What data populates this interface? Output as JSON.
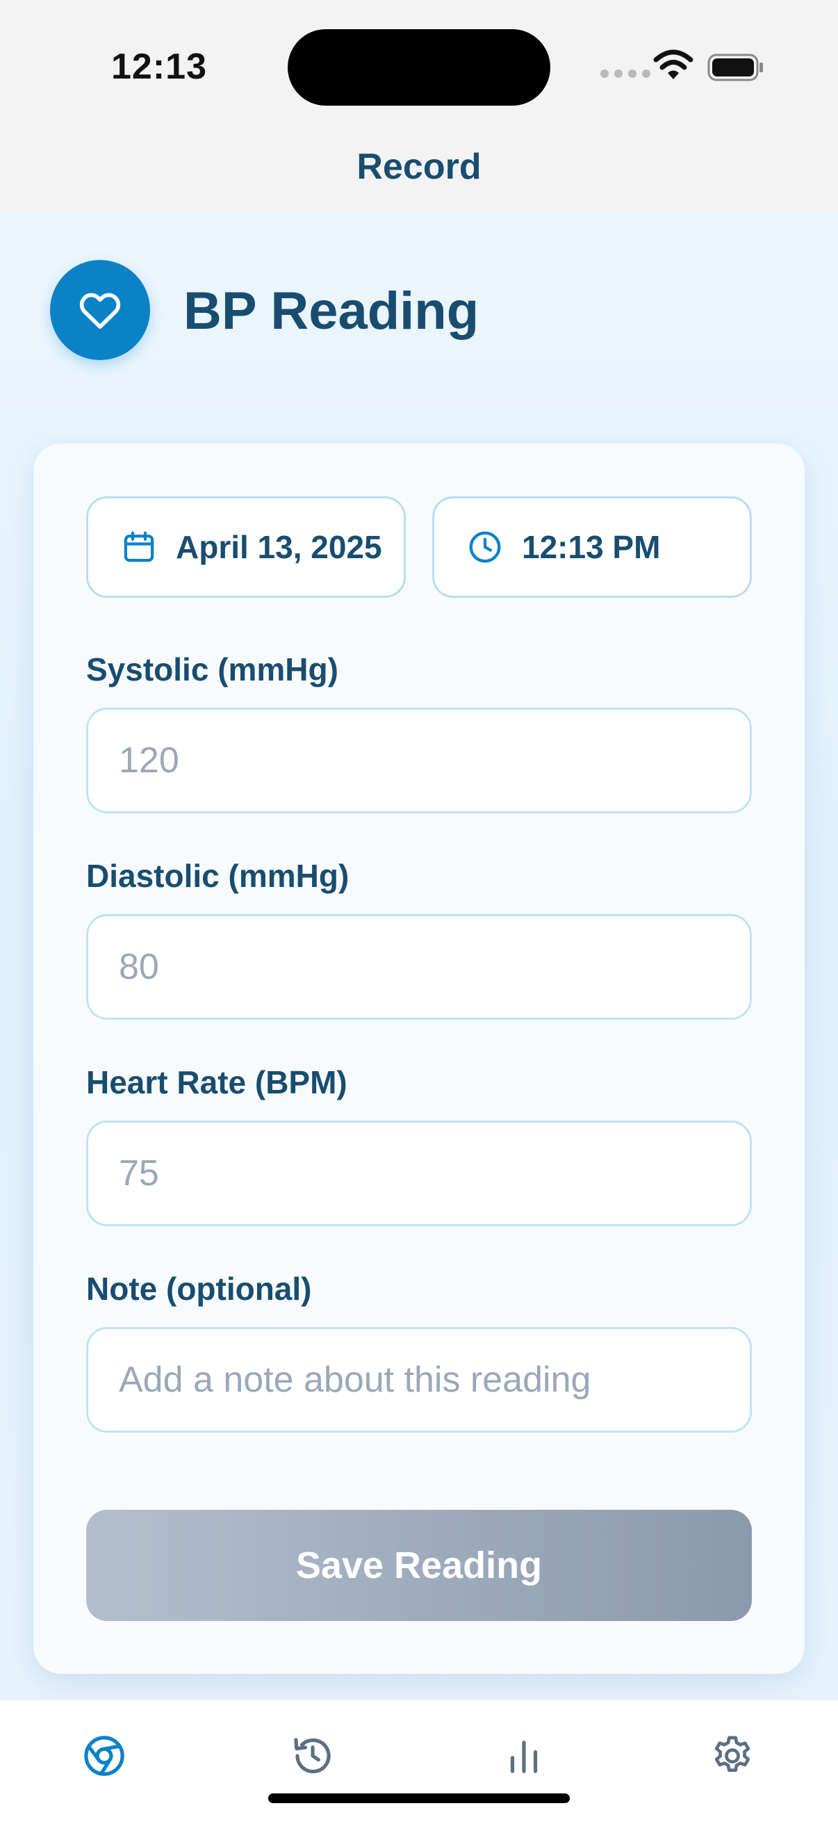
{
  "status_bar": {
    "time": "12:13"
  },
  "nav": {
    "title": "Record"
  },
  "header": {
    "icon": "heart-icon",
    "title": "BP Reading"
  },
  "form": {
    "date": {
      "icon": "calendar-icon",
      "value": "April 13, 2025"
    },
    "time": {
      "icon": "clock-icon",
      "value": "12:13 PM"
    },
    "systolic": {
      "label": "Systolic (mmHg)",
      "placeholder": "120",
      "value": ""
    },
    "diastolic": {
      "label": "Diastolic (mmHg)",
      "placeholder": "80",
      "value": ""
    },
    "heart_rate": {
      "label": "Heart Rate (BPM)",
      "placeholder": "75",
      "value": ""
    },
    "note": {
      "label": "Note (optional)",
      "placeholder": "Add a note about this reading",
      "value": ""
    },
    "save_label": "Save Reading"
  },
  "tabs": [
    {
      "icon": "record-icon",
      "active": true
    },
    {
      "icon": "history-icon",
      "active": false
    },
    {
      "icon": "stats-icon",
      "active": false
    },
    {
      "icon": "settings-icon",
      "active": false
    }
  ],
  "colors": {
    "accent": "#0b82c8",
    "title": "#184d70",
    "inactive_icon": "#5c6f82",
    "button_disabled_start": "#b3bfcd",
    "button_disabled_end": "#8c99ac"
  }
}
